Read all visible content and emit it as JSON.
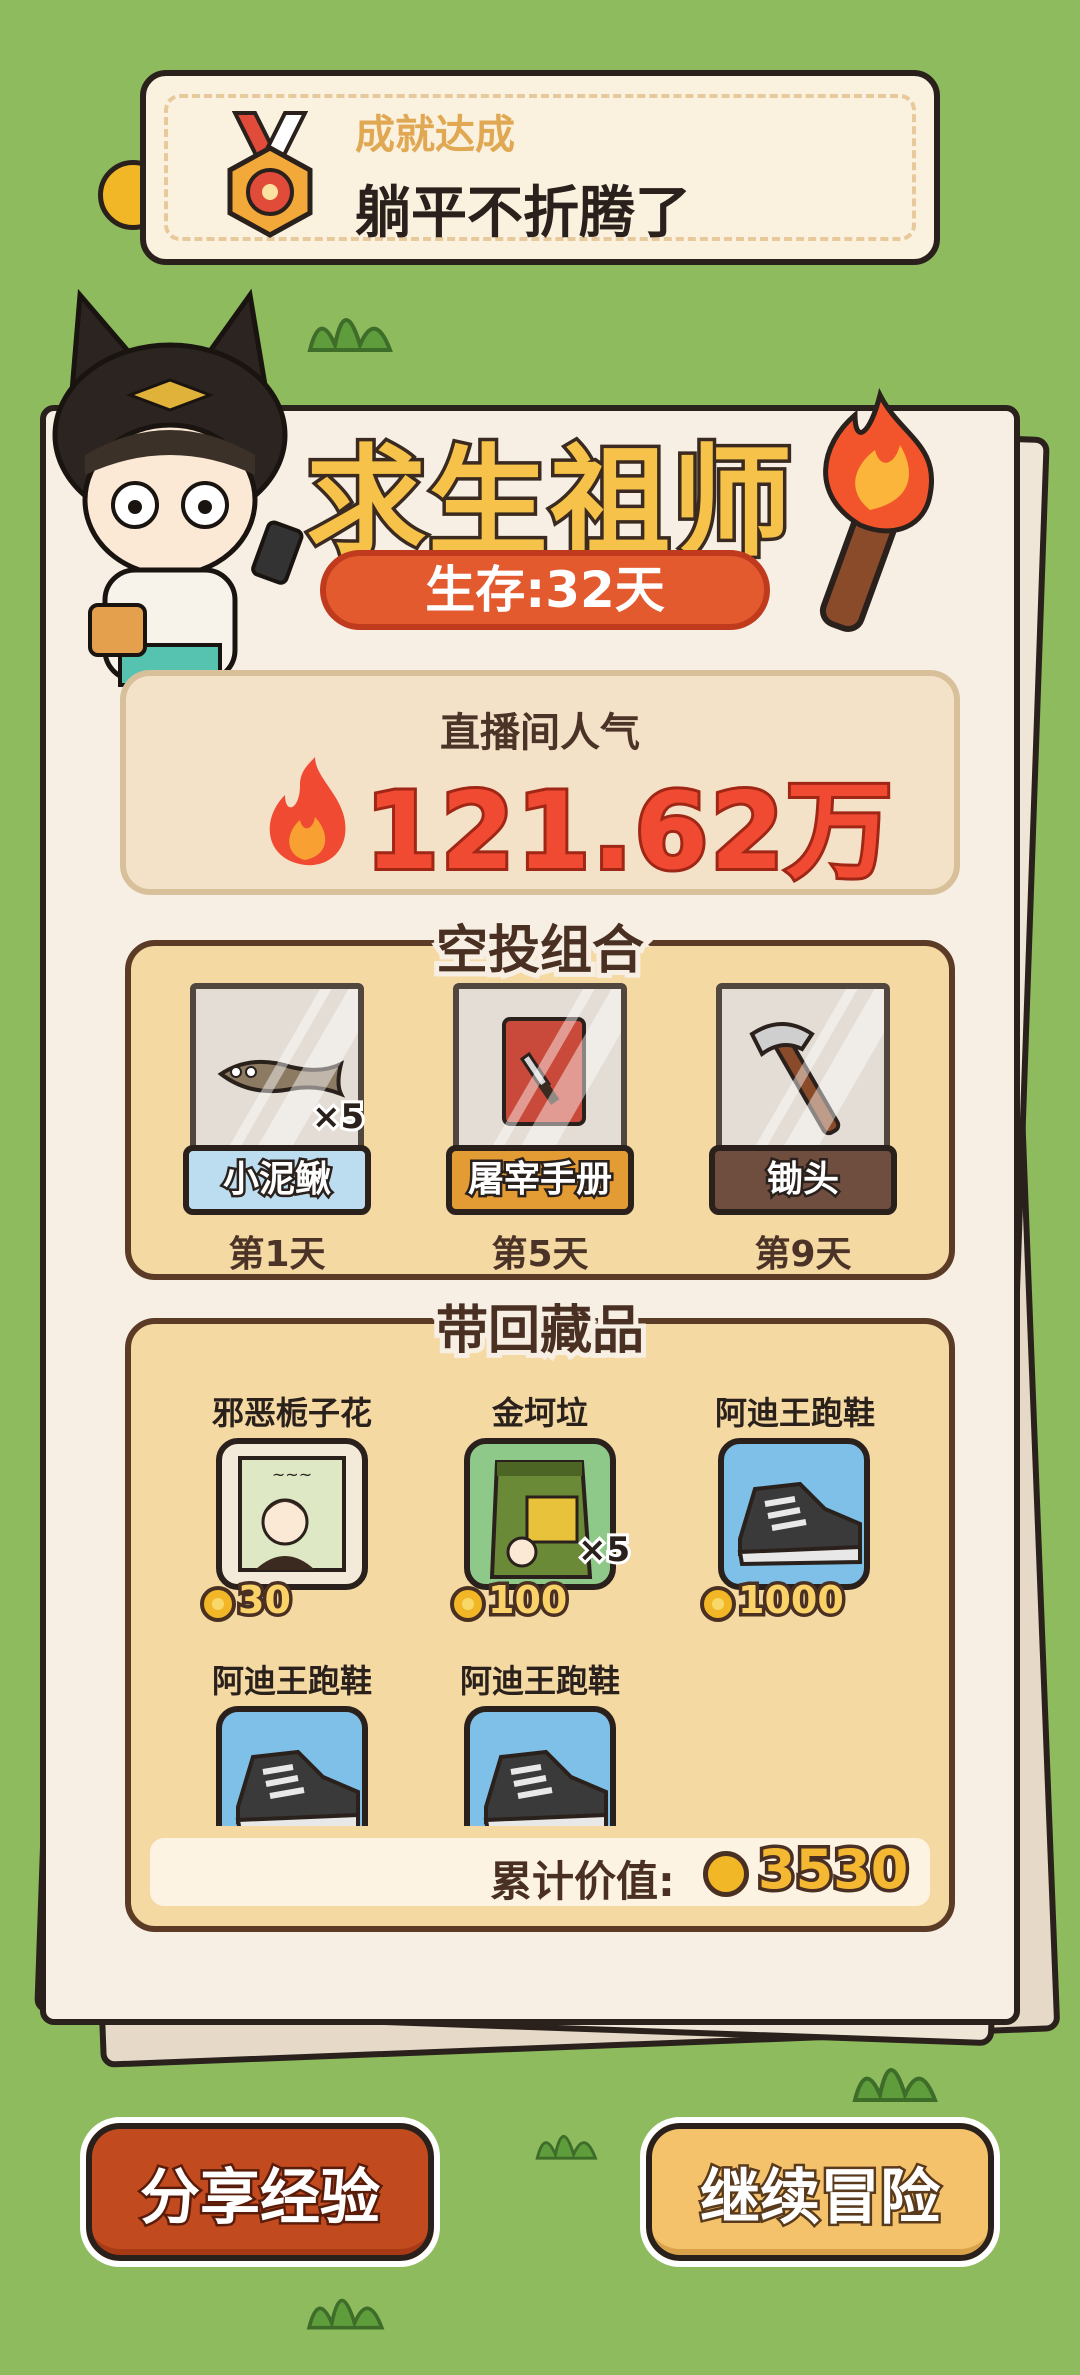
{
  "achievement": {
    "label": "成就达成",
    "title": "躺平不折腾了"
  },
  "result": {
    "title": "求生祖师",
    "survival": "生存:32天"
  },
  "popularity": {
    "label": "直播间人气",
    "value": "121.62万"
  },
  "airdrop": {
    "title": "空投组合",
    "items": [
      {
        "name": "小泥鳅",
        "day": "第1天",
        "quantity": "×5",
        "icon": "loach-icon",
        "tag_color": "#bcdcef"
      },
      {
        "name": "屠宰手册",
        "day": "第5天",
        "quantity": "",
        "icon": "butcher-manual-icon",
        "tag_color": "#e39b34"
      },
      {
        "name": "锄头",
        "day": "第9天",
        "quantity": "",
        "icon": "hoe-icon",
        "tag_color": "#6f4d3f"
      }
    ]
  },
  "collectibles": {
    "title": "带回藏品",
    "items": [
      {
        "name": "邪恶栀子花",
        "price": "30",
        "quantity": "",
        "icon": "poster-icon"
      },
      {
        "name": "金坷垃",
        "price": "100",
        "quantity": "×5",
        "icon": "fertilizer-bag-icon"
      },
      {
        "name": "阿迪王跑鞋",
        "price": "1000",
        "quantity": "",
        "icon": "sneaker-icon"
      },
      {
        "name": "阿迪王跑鞋",
        "price": "",
        "quantity": "",
        "icon": "sneaker-icon"
      },
      {
        "name": "阿迪王跑鞋",
        "price": "",
        "quantity": "",
        "icon": "sneaker-icon"
      }
    ],
    "total_label": "累计价值:",
    "total_value": "3530"
  },
  "buttons": {
    "share": "分享经验",
    "continue": "继续冒险"
  },
  "colors": {
    "background": "#8fbb5f",
    "accent_red": "#f04a33",
    "gold": "#f6c24a"
  }
}
